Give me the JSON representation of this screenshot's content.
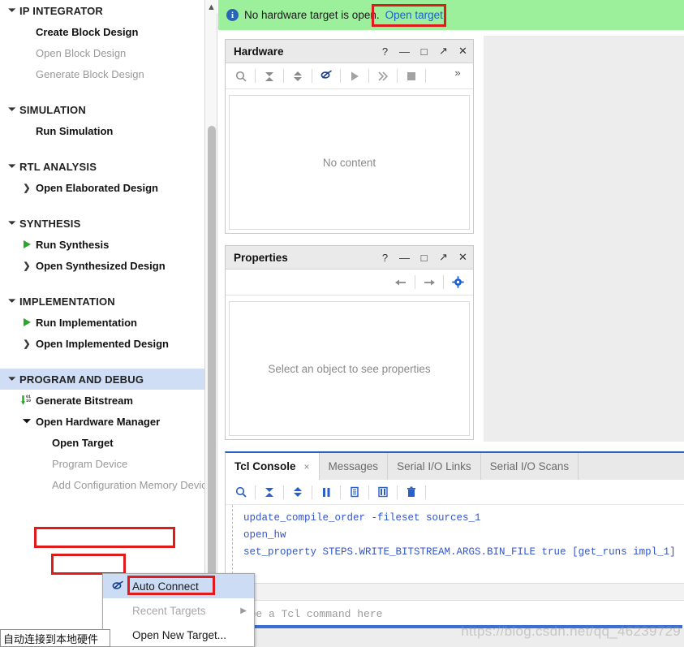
{
  "banner": {
    "icon": "info-icon",
    "message": "No hardware target is open.",
    "link_label": "Open target"
  },
  "flow_navigator": {
    "sections": [
      {
        "label": "IP INTEGRATOR",
        "chevron": "chevron-down-icon",
        "items": [
          {
            "label": "Create Block Design",
            "state": "enabled",
            "icon": ""
          },
          {
            "label": "Open Block Design",
            "state": "disabled",
            "icon": ""
          },
          {
            "label": "Generate Block Design",
            "state": "disabled",
            "icon": ""
          }
        ]
      },
      {
        "label": "SIMULATION",
        "chevron": "chevron-down-icon",
        "items": [
          {
            "label": "Run Simulation",
            "state": "enabled",
            "icon": ""
          }
        ]
      },
      {
        "label": "RTL ANALYSIS",
        "chevron": "chevron-down-icon",
        "items": [
          {
            "label": "Open Elaborated Design",
            "state": "enabled",
            "icon": "chevron-right-icon"
          }
        ]
      },
      {
        "label": "SYNTHESIS",
        "chevron": "chevron-down-icon",
        "items": [
          {
            "label": "Run Synthesis",
            "state": "enabled",
            "icon": "play-icon"
          },
          {
            "label": "Open Synthesized Design",
            "state": "enabled",
            "icon": "chevron-right-icon"
          }
        ]
      },
      {
        "label": "IMPLEMENTATION",
        "chevron": "chevron-down-icon",
        "items": [
          {
            "label": "Run Implementation",
            "state": "enabled",
            "icon": "play-icon"
          },
          {
            "label": "Open Implemented Design",
            "state": "enabled",
            "icon": "chevron-right-icon"
          }
        ]
      },
      {
        "label": "PROGRAM AND DEBUG",
        "chevron": "chevron-down-icon",
        "selected": true,
        "items": [
          {
            "label": "Generate Bitstream",
            "state": "enabled",
            "icon": "bitstream-icon"
          },
          {
            "label": "Open Hardware Manager",
            "state": "enabled",
            "icon": "chevron-down-icon",
            "annotated": true
          },
          {
            "label": "Open Target",
            "state": "enabled",
            "icon": "",
            "annotated": true
          },
          {
            "label": "Program Device",
            "state": "disabled",
            "icon": ""
          },
          {
            "label": "Add Configuration Memory Device",
            "state": "disabled",
            "icon": ""
          }
        ]
      }
    ]
  },
  "hardware_panel": {
    "title": "Hardware",
    "window_buttons": [
      "?",
      "—",
      "□",
      "↗",
      "×"
    ],
    "toolbar": [
      "search-icon",
      "collapse-all-icon",
      "expand-all-icon",
      "auto-connect-icon",
      "run-icon",
      "step-icon",
      "stop-icon",
      "more-icon"
    ],
    "empty_text": "No content"
  },
  "properties_panel": {
    "title": "Properties",
    "window_buttons": [
      "?",
      "—",
      "□",
      "↗",
      "×"
    ],
    "toolbar": [
      "back-arrow-icon",
      "forward-arrow-icon",
      "gear-icon"
    ],
    "empty_text": "Select an object to see properties"
  },
  "tcl_console": {
    "tabs": [
      {
        "label": "Tcl Console",
        "active": true,
        "closable": true
      },
      {
        "label": "Messages",
        "active": false,
        "closable": false
      },
      {
        "label": "Serial I/O Links",
        "active": false,
        "closable": false
      },
      {
        "label": "Serial I/O Scans",
        "active": false,
        "closable": false
      }
    ],
    "close_glyph": "×",
    "toolbar": [
      "search-icon",
      "collapse-icon",
      "expand-icon",
      "pause-icon",
      "copy-icon",
      "wrap-icon",
      "clear-icon"
    ],
    "log_lines": [
      "update_compile_order -fileset sources_1",
      "open_hw",
      "set_property STEPS.WRITE_BITSTREAM.ARGS.BIN_FILE true [get_runs impl_1]"
    ],
    "scroll_left_glyph": "‹",
    "input_placeholder": "Type a Tcl command here"
  },
  "context_menu": {
    "items": [
      {
        "label": "Auto Connect",
        "icon": "auto-connect-icon",
        "state": "enabled",
        "selected": true,
        "submenu": false
      },
      {
        "label": "Recent Targets",
        "icon": "",
        "state": "disabled",
        "selected": false,
        "submenu": true
      },
      {
        "label": "Open New Target...",
        "icon": "",
        "state": "enabled",
        "selected": false,
        "submenu": false
      }
    ],
    "submenu_glyph": "▶"
  },
  "tooltip": {
    "text": "自动连接到本地硬件"
  },
  "watermark": {
    "text": "https://blog.csdn.net/qq_46239729"
  },
  "colors": {
    "banner_green": "#9cf09c",
    "link_blue": "#1a5fd0",
    "annotation_red": "#e01b1b",
    "section_highlight": "#cfdef5",
    "tcl_text_blue": "#3355cc",
    "play_green": "#2aa82a"
  }
}
